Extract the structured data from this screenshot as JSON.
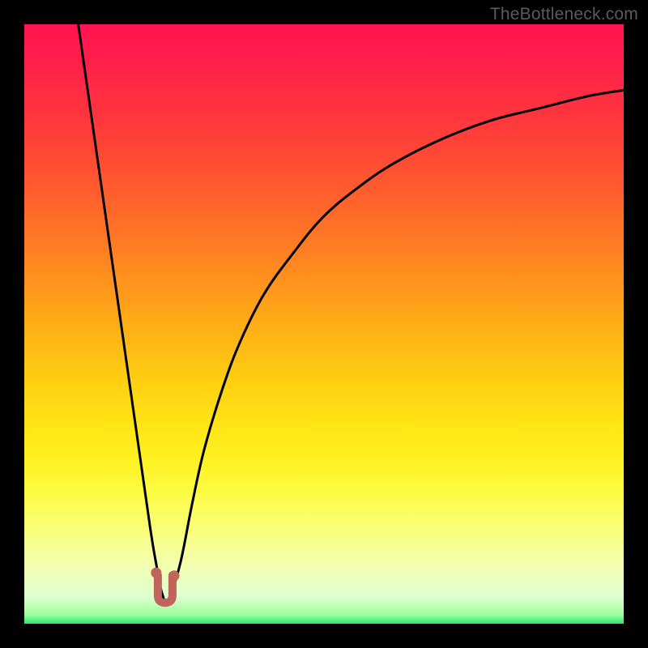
{
  "watermark": "TheBottleneck.com",
  "colors": {
    "frame": "#000000",
    "curve": "#000000",
    "marker": "#c1645b",
    "gradient_stops": [
      {
        "offset": 0.0,
        "color": "#ff1450"
      },
      {
        "offset": 0.06,
        "color": "#ff1f4a"
      },
      {
        "offset": 0.12,
        "color": "#ff2d42"
      },
      {
        "offset": 0.18,
        "color": "#ff3d3a"
      },
      {
        "offset": 0.24,
        "color": "#ff5032"
      },
      {
        "offset": 0.3,
        "color": "#ff642b"
      },
      {
        "offset": 0.36,
        "color": "#ff7924"
      },
      {
        "offset": 0.42,
        "color": "#ff8f1e"
      },
      {
        "offset": 0.48,
        "color": "#ffa518"
      },
      {
        "offset": 0.54,
        "color": "#ffbb14"
      },
      {
        "offset": 0.6,
        "color": "#ffd012"
      },
      {
        "offset": 0.66,
        "color": "#ffe215"
      },
      {
        "offset": 0.72,
        "color": "#fff01f"
      },
      {
        "offset": 0.78,
        "color": "#fdfb42"
      },
      {
        "offset": 0.84,
        "color": "#f9ff76"
      },
      {
        "offset": 0.9,
        "color": "#f3ffae"
      },
      {
        "offset": 0.955,
        "color": "#e0ffd1"
      },
      {
        "offset": 0.985,
        "color": "#9cff9c"
      },
      {
        "offset": 1.0,
        "color": "#28e86f"
      }
    ]
  },
  "chart_data": {
    "type": "line",
    "title": "",
    "xlabel": "",
    "ylabel": "",
    "xlim": [
      0,
      100
    ],
    "ylim": [
      0,
      100
    ],
    "grid": false,
    "legend": null,
    "series": [
      {
        "name": "bottleneck-curve",
        "x": [
          9,
          11,
          13,
          15,
          17,
          19,
          21,
          22,
          23,
          24,
          26,
          28,
          30,
          33,
          36,
          40,
          45,
          50,
          56,
          62,
          70,
          78,
          86,
          94,
          100
        ],
        "y": [
          100,
          86,
          72,
          58,
          44,
          30,
          16,
          10,
          5,
          4,
          10,
          20,
          29,
          39,
          47,
          55,
          62,
          68,
          73,
          77,
          81,
          84,
          86,
          88,
          89
        ]
      }
    ],
    "minimum": {
      "x": 23.5,
      "y": 3.5
    },
    "markers": [
      {
        "x": 22.0,
        "y": 8.5
      },
      {
        "x": 25.0,
        "y": 8.0
      }
    ],
    "annotations": []
  }
}
